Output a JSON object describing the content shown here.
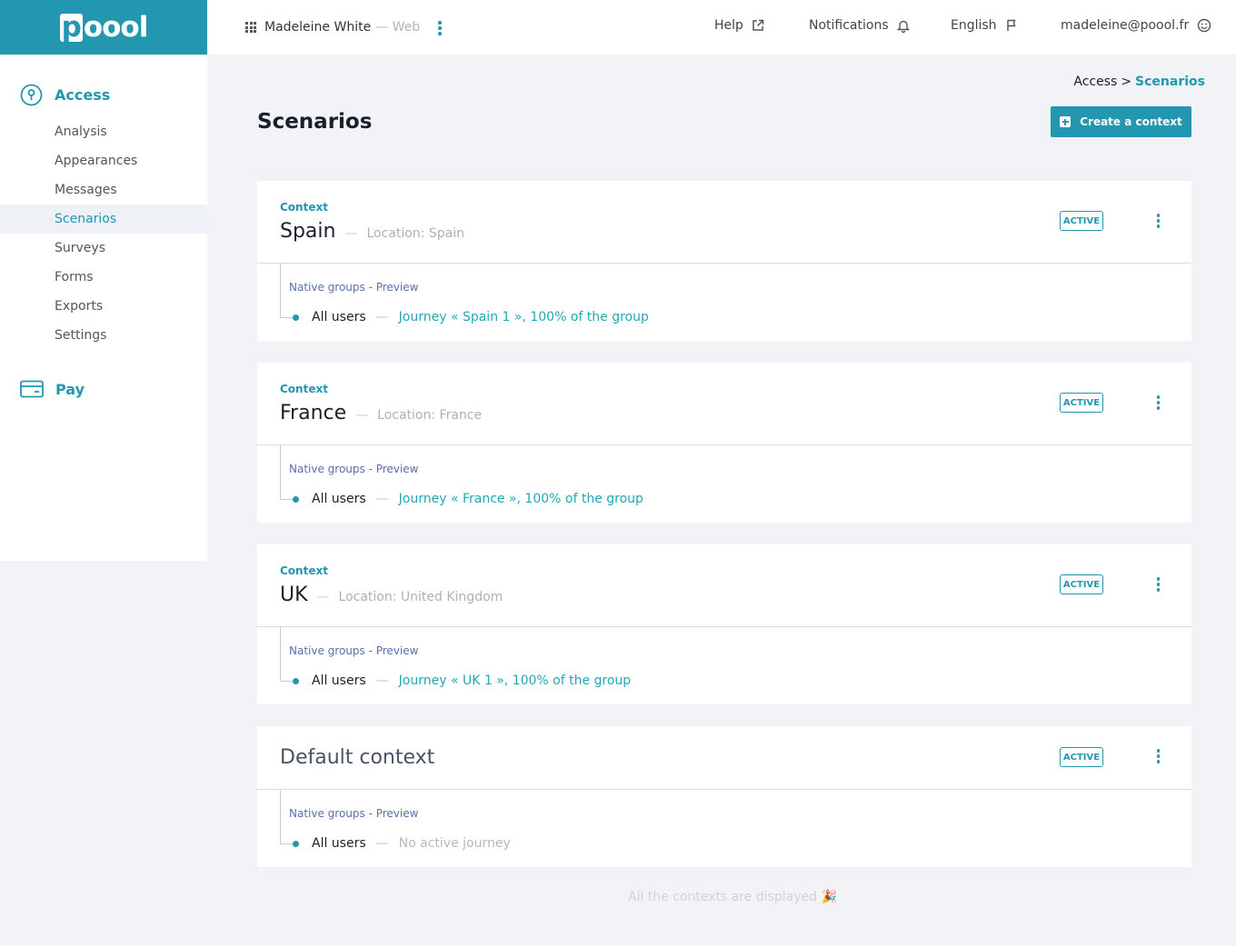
{
  "brand": {
    "logo": "poool",
    "logo_first": "p",
    "logo_rest": "oool",
    "color": "#2396b0"
  },
  "topbar": {
    "app_switch": {
      "icon": "grid-icon",
      "user": "Madeleine White",
      "sub": "— Web"
    },
    "help": {
      "label": "Help",
      "icon": "external-link-icon"
    },
    "notifications": {
      "label": "Notifications",
      "icon": "bell-icon"
    },
    "language": {
      "label": "English",
      "icon": "flag-icon"
    },
    "account": {
      "label": "madeleine@poool.fr",
      "icon": "smiley-icon"
    }
  },
  "sidebar": {
    "access": {
      "label": "Access",
      "icon": "keyhole-icon"
    },
    "items": [
      {
        "label": "Analysis"
      },
      {
        "label": "Appearances"
      },
      {
        "label": "Messages"
      },
      {
        "label": "Scenarios",
        "active": true
      },
      {
        "label": "Surveys"
      },
      {
        "label": "Forms"
      },
      {
        "label": "Exports"
      },
      {
        "label": "Settings"
      }
    ],
    "pay": {
      "label": "Pay",
      "icon": "credit-card-icon"
    }
  },
  "breadcrumb": {
    "root": "Access",
    "sep": ">",
    "current": "Scenarios"
  },
  "page": {
    "title": "Scenarios",
    "create_button": "Create a context"
  },
  "contexts": [
    {
      "label": "Context",
      "name": "Spain",
      "dash": "—",
      "location": "Location: Spain",
      "status": "ACTIVE",
      "group_label": "Native groups - Preview",
      "users": "All users",
      "sep": "—",
      "journey": "Journey « Spain 1 », 100% of the group"
    },
    {
      "label": "Context",
      "name": "France",
      "dash": "—",
      "location": "Location: France",
      "status": "ACTIVE",
      "group_label": "Native groups - Preview",
      "users": "All users",
      "sep": "—",
      "journey": "Journey « France », 100% of the group"
    },
    {
      "label": "Context",
      "name": "UK",
      "dash": "—",
      "location": "Location: United Kingdom",
      "status": "ACTIVE",
      "group_label": "Native groups - Preview",
      "users": "All users",
      "sep": "—",
      "journey": "Journey « UK 1 », 100% of the group"
    },
    {
      "name": "Default context",
      "status": "ACTIVE",
      "group_label": "Native groups - Preview",
      "users": "All users",
      "sep": "—",
      "journey": "No active journey"
    }
  ],
  "footer": {
    "note": "All the contexts are displayed 🎉"
  },
  "colors": {
    "accent": "#2396b0",
    "journey": "#22a8b4",
    "group_label": "#5a6fb0",
    "background": "#f1f3f6"
  }
}
